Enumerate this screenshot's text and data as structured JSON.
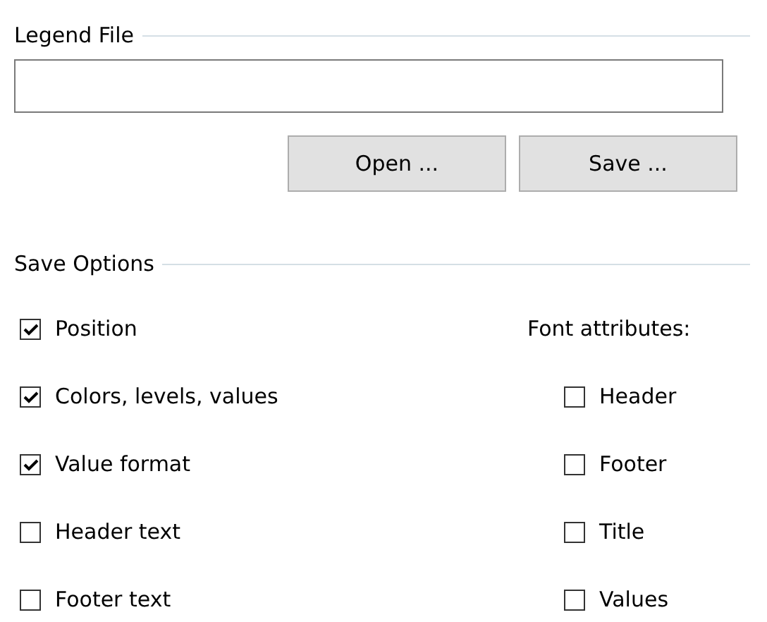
{
  "legend_file": {
    "title": "Legend File",
    "buttons": [
      "Open ...",
      "Save ..."
    ]
  },
  "save_options": {
    "title": "Save Options",
    "options": [
      {
        "label": "Position",
        "checked": true
      },
      {
        "label": "Colors, levels, values",
        "checked": true
      },
      {
        "label": "Value format",
        "checked": true
      },
      {
        "label": "Header text",
        "checked": false
      },
      {
        "label": "Footer text",
        "checked": false
      }
    ],
    "font_attributes": {
      "label": "Font attributes:",
      "items": [
        {
          "label": "Header",
          "checked": false
        },
        {
          "label": "Footer",
          "checked": false
        },
        {
          "label": "Title",
          "checked": false
        },
        {
          "label": "Values",
          "checked": false
        }
      ]
    }
  }
}
